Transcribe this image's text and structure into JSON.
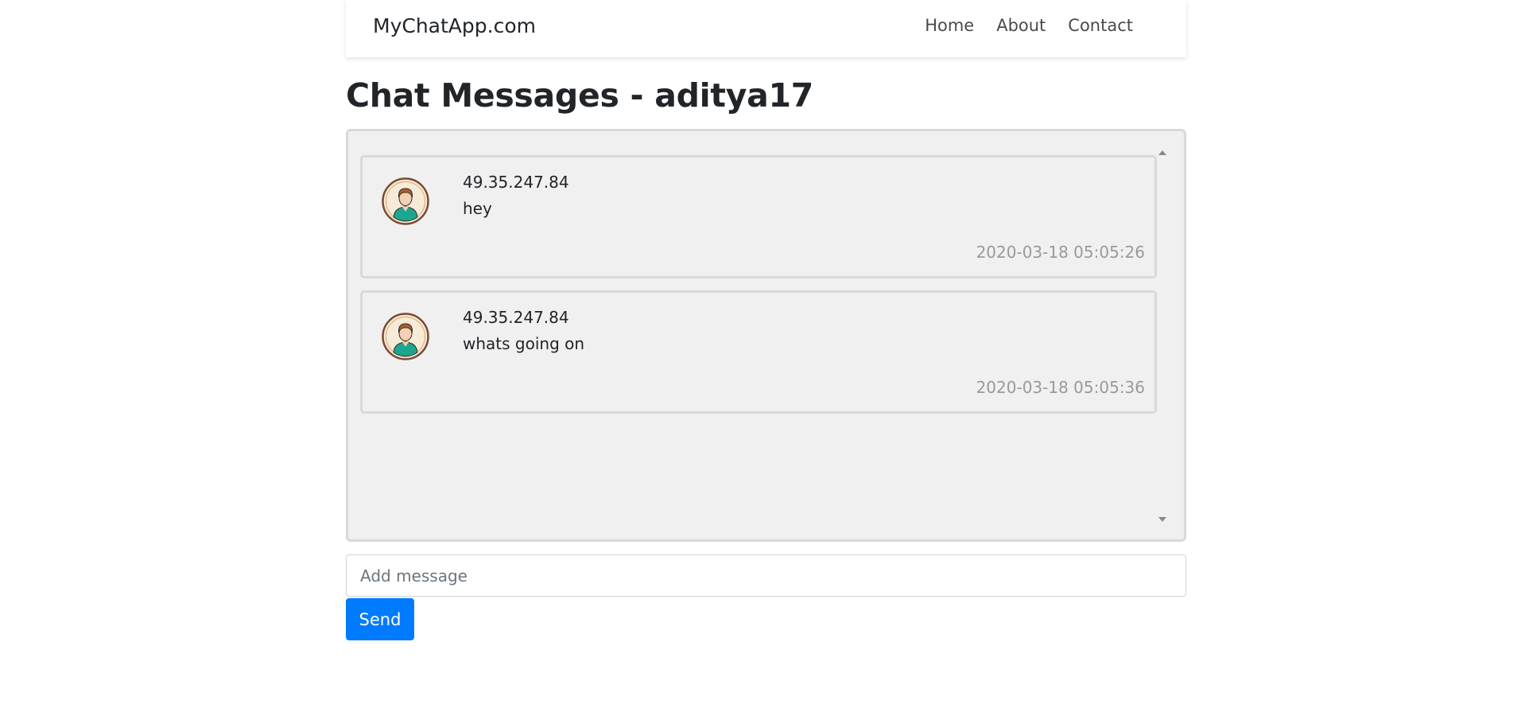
{
  "navbar": {
    "brand": "MyChatApp.com",
    "links": [
      {
        "label": "Home"
      },
      {
        "label": "About"
      },
      {
        "label": "Contact"
      }
    ]
  },
  "page": {
    "title": "Chat Messages - aditya17"
  },
  "messages": [
    {
      "sender": "49.35.247.84",
      "text": "hey",
      "timestamp": "2020-03-18 05:05:26",
      "avatar_icon": "user-avatar-icon"
    },
    {
      "sender": "49.35.247.84",
      "text": "whats going on",
      "timestamp": "2020-03-18 05:05:36",
      "avatar_icon": "user-avatar-icon"
    }
  ],
  "composer": {
    "placeholder": "Add message",
    "value": "",
    "send_label": "Send"
  },
  "colors": {
    "primary": "#007bff",
    "chat_bg": "#f0f0f0",
    "timestamp": "#9a9a9a"
  }
}
